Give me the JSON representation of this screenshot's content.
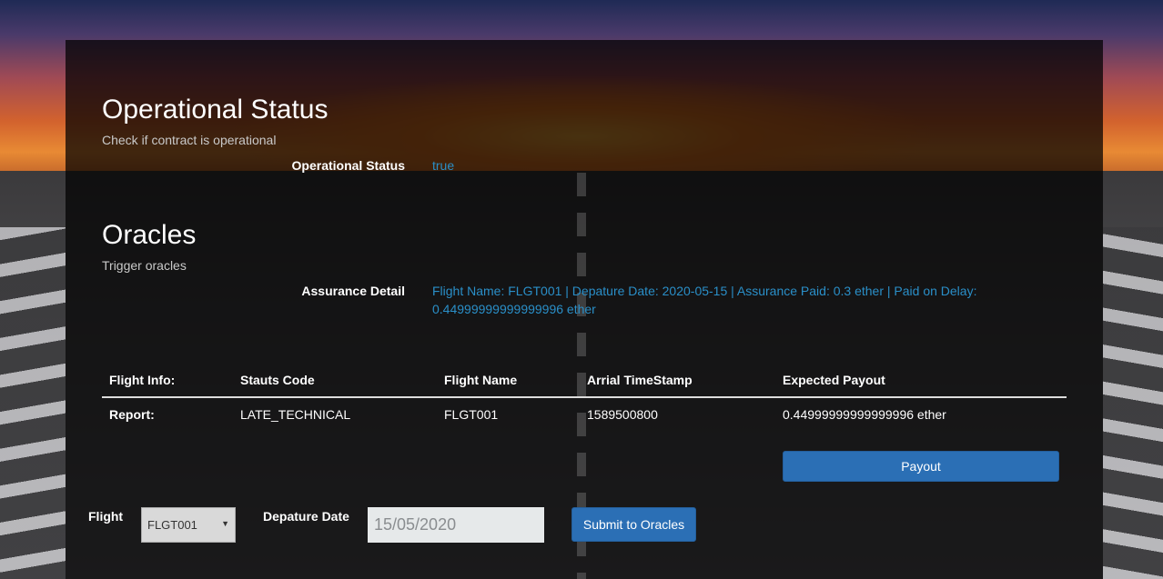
{
  "operational": {
    "title": "Operational Status",
    "subtitle": "Check if contract is operational",
    "status_label": "Operational Status",
    "status_value": "true"
  },
  "oracles": {
    "title": "Oracles",
    "subtitle": "Trigger oracles",
    "assurance_label": "Assurance Detail",
    "assurance_value": "Flight Name: FLGT001 | Depature Date: 2020-05-15 | Assurance Paid: 0.3 ether | Paid on Delay: 0.44999999999999996 ether"
  },
  "flight_table": {
    "headers": [
      "Flight Info:",
      "Stauts Code",
      "Flight Name",
      "Arrial TimeStamp",
      "Expected Payout"
    ],
    "rows": [
      [
        "Report:",
        "LATE_TECHNICAL",
        "FLGT001",
        "1589500800",
        "0.44999999999999996 ether"
      ]
    ]
  },
  "payout_button": "Payout",
  "form": {
    "flight_label": "Flight",
    "flight_selected": "FLGT001",
    "date_label": "Depature Date",
    "date_value": "15/05/2020",
    "submit_label": "Submit to Oracles"
  },
  "colors": {
    "link_value": "#2a8fc8",
    "button": "#2b6fb5"
  },
  "icons": {
    "select_caret": "caret-down-icon"
  }
}
